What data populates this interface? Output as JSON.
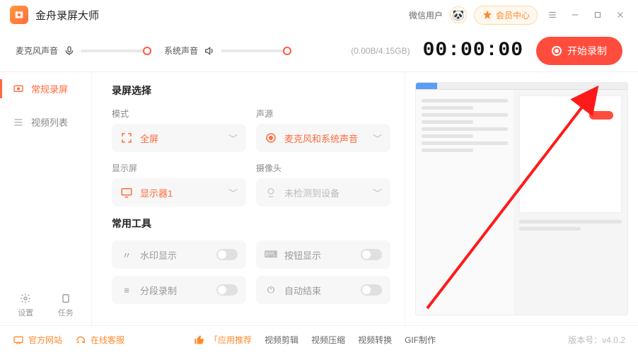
{
  "app": {
    "title": "金舟录屏大师"
  },
  "header": {
    "wx_user": "微信用户",
    "vip": "会员中心"
  },
  "topbar": {
    "mic_label": "麦克风声音",
    "sys_label": "系统声音",
    "storage": "(0.00B/4.15GB)",
    "timer": "00:00:00",
    "start": "开始录制"
  },
  "sidebar": {
    "items": [
      {
        "label": "常规录屏"
      },
      {
        "label": "视频列表"
      }
    ],
    "settings": "设置",
    "tasks": "任务"
  },
  "content": {
    "section_options": "录屏选择",
    "mode_label": "模式",
    "mode_value": "全屏",
    "audio_label": "声源",
    "audio_value": "麦克风和系统声音",
    "display_label": "显示屏",
    "display_value": "显示器1",
    "camera_label": "摄像头",
    "camera_value": "未检测到设备",
    "section_tools": "常用工具",
    "tools": [
      {
        "label": "水印显示"
      },
      {
        "label": "按钮显示"
      },
      {
        "label": "分段录制"
      },
      {
        "label": "自动结束"
      }
    ]
  },
  "footer": {
    "website": "官方网站",
    "support": "在线客服",
    "recommend": "「应用推荐",
    "links": [
      "视频剪辑",
      "视频压缩",
      "视频转换",
      "GIF制作"
    ],
    "version": "版本号：v4.0.2"
  }
}
